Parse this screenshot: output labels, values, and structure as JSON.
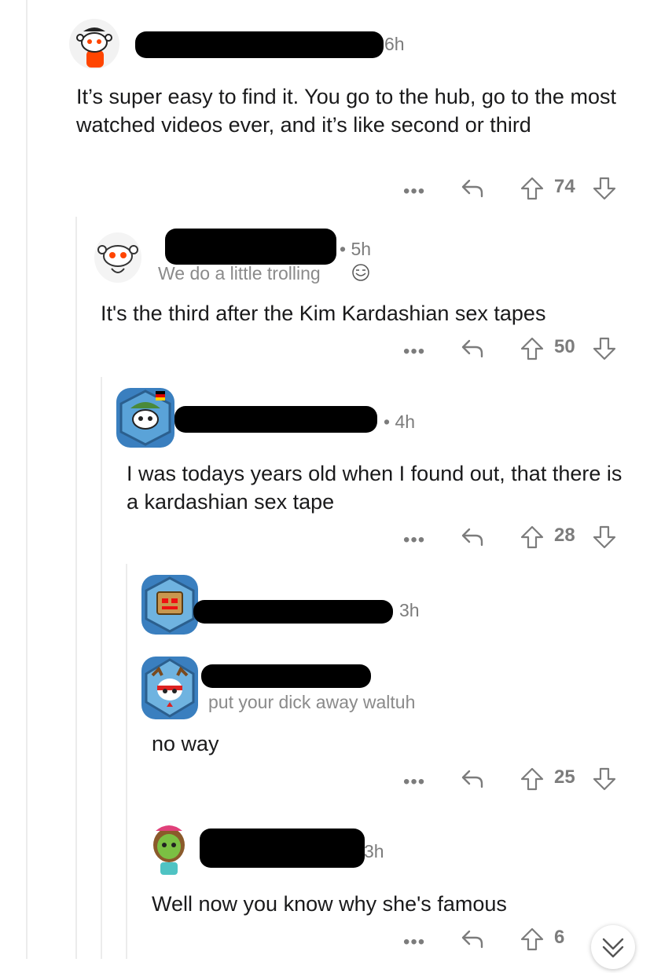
{
  "comments": [
    {
      "time": "6h",
      "body": "It’s super easy to find it. You go to the hub, go to the most watched videos ever, and it’s like second or third",
      "more": "•••",
      "score": "74"
    },
    {
      "time": "• 5h",
      "flair": "We do a little trolling",
      "body": "It's the third after the Kim Kardashian sex tapes",
      "more": "•••",
      "score": "50"
    },
    {
      "time": "• 4h",
      "body": "I was todays years old when I found out, that there is a kardashian sex tape",
      "more": "•••",
      "score": "28"
    },
    {
      "time": "3h"
    },
    {
      "flair": "put your dick away waltuh",
      "body": "no way",
      "more": "•••",
      "score": "25"
    },
    {
      "time": "3h",
      "body": "Well now you know why she's famous",
      "more": "•••",
      "score": "6"
    }
  ],
  "icons": {
    "reply": "reply-arrow-icon",
    "upvote": "upvote-arrow-icon",
    "downvote": "downvote-arrow-icon",
    "scroll": "chevron-double-down-icon"
  }
}
